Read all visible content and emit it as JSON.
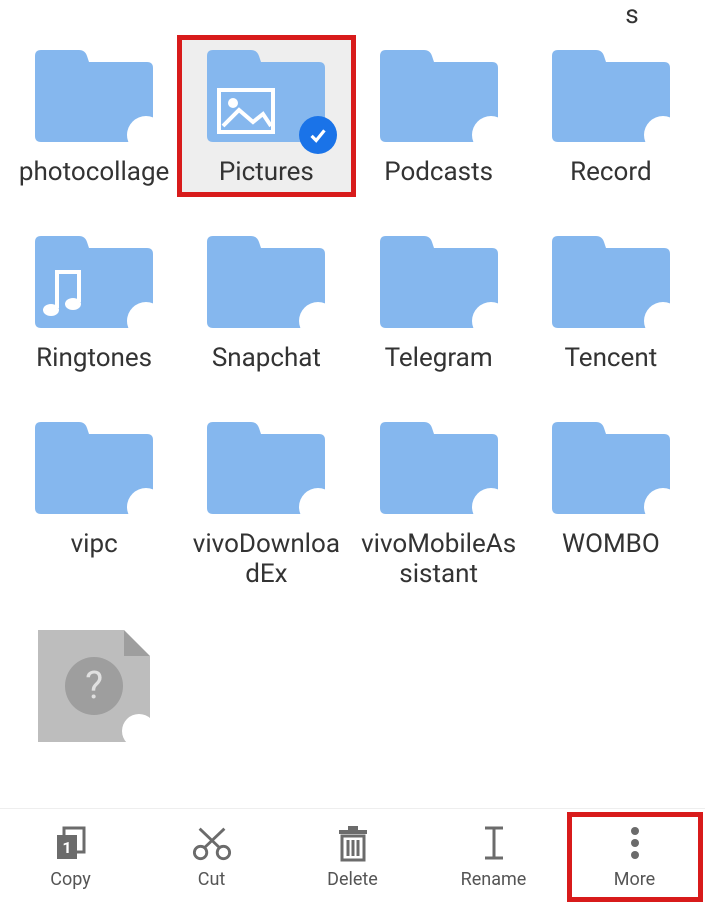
{
  "partial_row_label": "s",
  "folders": [
    {
      "name": "photocollage",
      "selected": false,
      "inner": null
    },
    {
      "name": "Pictures",
      "selected": true,
      "inner": "image",
      "highlighted": true
    },
    {
      "name": "Podcasts",
      "selected": false,
      "inner": null
    },
    {
      "name": "Record",
      "selected": false,
      "inner": null
    },
    {
      "name": "Ringtones",
      "selected": false,
      "inner": "music"
    },
    {
      "name": "Snapchat",
      "selected": false,
      "inner": null
    },
    {
      "name": "Telegram",
      "selected": false,
      "inner": null
    },
    {
      "name": "Tencent",
      "selected": false,
      "inner": null
    },
    {
      "name": "vipc",
      "selected": false,
      "inner": null
    },
    {
      "name": "vivoDownloadEx",
      "selected": false,
      "inner": null
    },
    {
      "name": "vivoMobileAssistant",
      "selected": false,
      "inner": null
    },
    {
      "name": "WOMBO",
      "selected": false,
      "inner": null
    }
  ],
  "unknown_file": {
    "visible": true
  },
  "toolbar": {
    "copy": {
      "label": "Copy",
      "count": "1"
    },
    "cut": {
      "label": "Cut"
    },
    "delete": {
      "label": "Delete"
    },
    "rename": {
      "label": "Rename"
    },
    "more": {
      "label": "More",
      "highlighted": true
    }
  },
  "colors": {
    "folder": "#85b7ee",
    "folder_tab": "#85b7ee",
    "highlight": "#d81b1b",
    "selected_check": "#1a73e8"
  }
}
